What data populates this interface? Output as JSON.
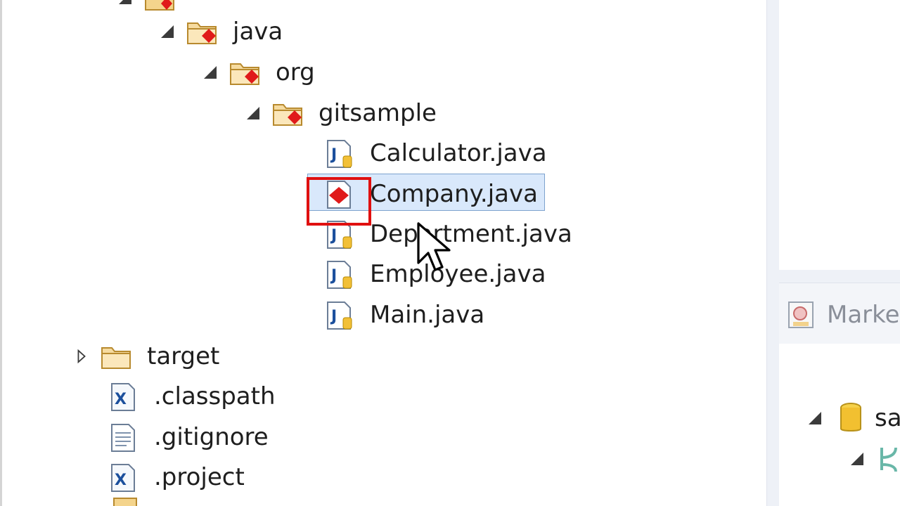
{
  "tree": {
    "java": "java",
    "org": "org",
    "gitsample": "gitsample",
    "files": [
      "Calculator.java",
      "Company.java",
      "Department.java",
      "Employee.java",
      "Main.java"
    ],
    "target": "target",
    "classpath": ".classpath",
    "gitignore": ".gitignore",
    "project": ".project"
  },
  "right_panel": {
    "tab_label": "Marke",
    "item_label": "sa"
  },
  "colors": {
    "selection": "#d9e8fb",
    "highlight_box": "#e01010",
    "error_marker": "#e01a1a"
  },
  "icons": [
    "package-folder-icon",
    "java-file-icon",
    "java-error-file-icon",
    "folder-icon",
    "xml-file-icon",
    "text-file-icon",
    "markers-icon",
    "repository-icon"
  ]
}
